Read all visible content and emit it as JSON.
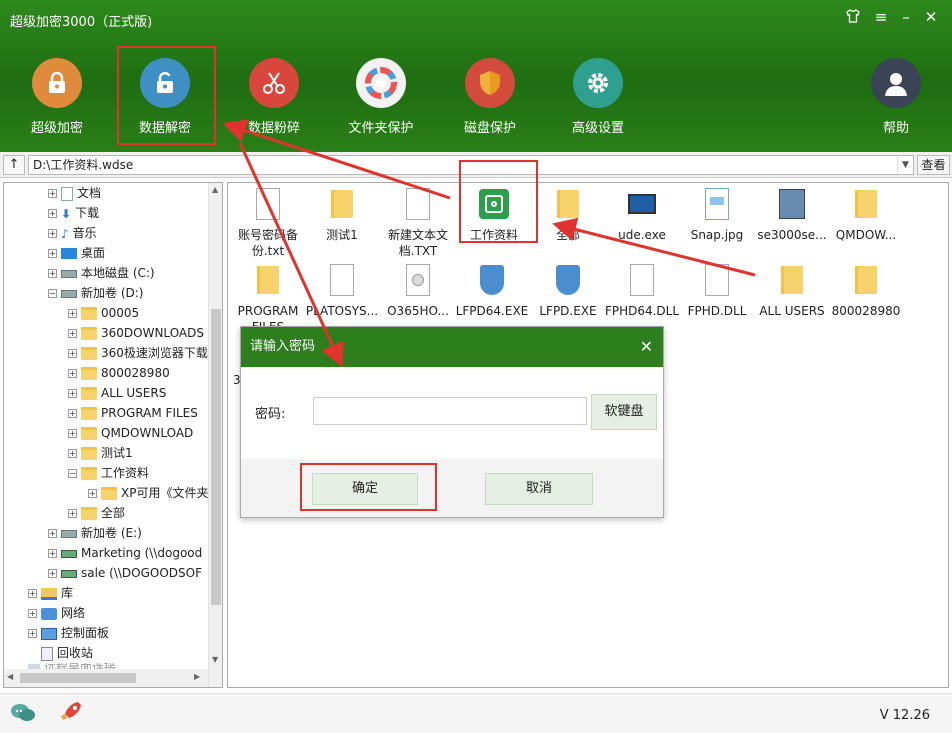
{
  "app": {
    "title": "超级加密3000（正式版)"
  },
  "toolbar": {
    "items": [
      {
        "label": "超级加密",
        "icon": "lock-icon"
      },
      {
        "label": "数据解密",
        "icon": "unlock-icon"
      },
      {
        "label": "数据粉碎",
        "icon": "scissors-icon"
      },
      {
        "label": "文件夹保护",
        "icon": "color-wheel-icon"
      },
      {
        "label": "磁盘保护",
        "icon": "shield-icon"
      },
      {
        "label": "高级设置",
        "icon": "gear-icon"
      },
      {
        "label": "帮助",
        "icon": "user-help-icon"
      }
    ]
  },
  "address": {
    "up": "↑",
    "path": "D:\\工作资料.wdse",
    "check": "查看"
  },
  "tree": {
    "items": [
      {
        "label": "文档",
        "icon": "document-icon"
      },
      {
        "label": "下载",
        "icon": "download-icon"
      },
      {
        "label": "音乐",
        "icon": "music-icon"
      },
      {
        "label": "桌面",
        "icon": "desktop-icon"
      },
      {
        "label": "本地磁盘 (C:)",
        "icon": "drive-icon"
      },
      {
        "label": "新加卷 (D:)",
        "icon": "drive-icon"
      },
      {
        "label": "00005",
        "icon": "folder-icon"
      },
      {
        "label": "360DOWNLOADS",
        "icon": "folder-icon"
      },
      {
        "label": "360极速浏览器下载",
        "icon": "folder-icon"
      },
      {
        "label": "800028980",
        "icon": "folder-icon"
      },
      {
        "label": "ALL USERS",
        "icon": "folder-icon"
      },
      {
        "label": "PROGRAM FILES",
        "icon": "folder-icon"
      },
      {
        "label": "QMDOWNLOAD",
        "icon": "folder-icon"
      },
      {
        "label": "测试1",
        "icon": "folder-icon"
      },
      {
        "label": "工作资料",
        "icon": "folder-icon"
      },
      {
        "label": "XP可用《文件夹",
        "icon": "folder-icon"
      },
      {
        "label": "全部",
        "icon": "folder-icon"
      },
      {
        "label": "新加卷 (E:)",
        "icon": "drive-icon"
      },
      {
        "label": "Marketing (\\\\dogood",
        "icon": "network-drive-icon"
      },
      {
        "label": "sale (\\\\DOGOODSOF",
        "icon": "network-drive-icon"
      },
      {
        "label": "库",
        "icon": "library-icon"
      },
      {
        "label": "网络",
        "icon": "network-icon"
      },
      {
        "label": "控制面板",
        "icon": "control-panel-icon"
      },
      {
        "label": "回收站",
        "icon": "recycle-bin-icon"
      },
      {
        "label": "远程桌面连接",
        "icon": "remote-icon"
      }
    ]
  },
  "files": {
    "items": [
      {
        "label": "账号密码备份.txt",
        "icon": "text-file-icon"
      },
      {
        "label": "测试1",
        "icon": "folder-icon"
      },
      {
        "label": "新建文本文档.TXT",
        "icon": "text-file-icon"
      },
      {
        "label": "工作资料",
        "icon": "safe-icon"
      },
      {
        "label": "全部",
        "icon": "folder-icon"
      },
      {
        "label": "ude.exe",
        "icon": "computer-icon"
      },
      {
        "label": "Snap.jpg",
        "icon": "image-file-icon"
      },
      {
        "label": "se3000se...",
        "icon": "installer-icon"
      },
      {
        "label": "QMDOW...",
        "icon": "folder-icon"
      },
      {
        "label": "PROGRAM FILES",
        "icon": "folder-icon"
      },
      {
        "label": "PLATOSYS...",
        "icon": "system-file-icon"
      },
      {
        "label": "O365HO...",
        "icon": "disc-file-icon"
      },
      {
        "label": "LFPD64.EXE",
        "icon": "exe-icon"
      },
      {
        "label": "LFPD.EXE",
        "icon": "exe-icon"
      },
      {
        "label": "FPHD64.DLL",
        "icon": "dll-icon"
      },
      {
        "label": "FPHD.DLL",
        "icon": "dll-icon"
      },
      {
        "label": "ALL USERS",
        "icon": "folder-icon"
      },
      {
        "label": "800028980",
        "icon": "folder-icon"
      },
      {
        "label": "36",
        "icon": ""
      }
    ]
  },
  "dialog": {
    "title": "请输入密码",
    "password_label": "密码:",
    "password_value": "",
    "keyboard_label": "软键盘",
    "ok_label": "确定",
    "cancel_label": "取消"
  },
  "status": {
    "version": "V 12.26"
  },
  "colors": {
    "brand_green": "#2d7f1d",
    "highlight_red": "#e0332e"
  }
}
